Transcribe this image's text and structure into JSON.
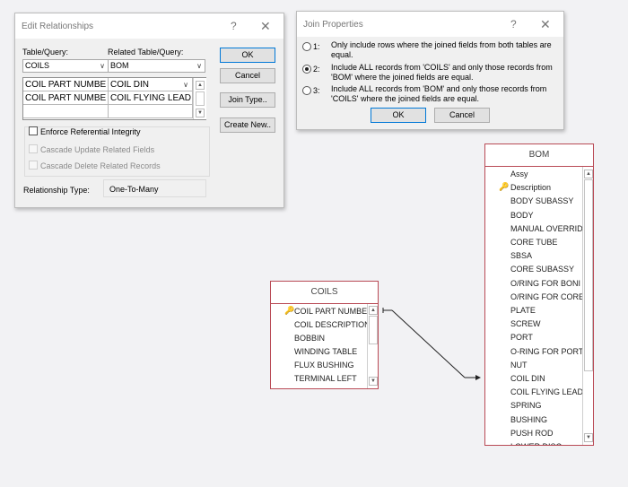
{
  "edit_relationships": {
    "title": "Edit Relationships",
    "help": "?",
    "close": "✕",
    "table_query_label": "Table/Query:",
    "related_table_query_label": "Related Table/Query:",
    "table_value": "COILS",
    "related_table_value": "BOM",
    "rows": [
      {
        "left": "COIL PART NUMBE",
        "right": "COIL DIN"
      },
      {
        "left": "COIL PART NUMBE",
        "right": "COIL FLYING LEAD"
      },
      {
        "left": "",
        "right": ""
      }
    ],
    "enforce_label": "Enforce Referential Integrity",
    "cascade_update_label": "Cascade Update Related Fields",
    "cascade_delete_label": "Cascade Delete Related Records",
    "relationship_type_label": "Relationship Type:",
    "relationship_type_value": "One-To-Many",
    "buttons": {
      "ok": "OK",
      "cancel": "Cancel",
      "join_type": "Join Type..",
      "create_new": "Create New.."
    }
  },
  "join_properties": {
    "title": "Join Properties",
    "help": "?",
    "close": "✕",
    "options": [
      {
        "num": "1:",
        "line1": "Only include rows where the joined fields from both tables are",
        "line2": "equal."
      },
      {
        "num": "2:",
        "line1": "Include ALL records from 'COILS' and only those records from",
        "line2": "'BOM' where the joined fields are equal."
      },
      {
        "num": "3:",
        "line1": "Include ALL records from 'BOM' and only those records from",
        "line2": "'COILS' where the joined fields are equal."
      }
    ],
    "selected_option": 2,
    "buttons": {
      "ok": "OK",
      "cancel": "Cancel"
    }
  },
  "coils_table": {
    "title": "COILS",
    "fields": [
      "COIL PART NUMBE",
      "COIL DESCRIPTION",
      "BOBBIN",
      "WINDING TABLE",
      "FLUX BUSHING",
      "TERMINAL LEFT"
    ]
  },
  "bom_table": {
    "title": "BOM",
    "fields": [
      "Assy",
      "Description",
      "BODY SUBASSY",
      "BODY",
      "MANUAL OVERRID",
      "CORE TUBE",
      "SBSA",
      "CORE SUBASSY",
      "O/RING FOR BONI",
      "O/RING FOR CORE",
      "PLATE",
      "SCREW",
      "PORT",
      "O-RING FOR PORT",
      "NUT",
      "COIL DIN",
      "COIL FLYING LEADS",
      "SPRING",
      "BUSHING",
      "PUSH ROD",
      "LOWER DISC"
    ]
  },
  "icons": {
    "key": "🔑",
    "up": "▲",
    "down": "▼",
    "chevron": "∨"
  }
}
